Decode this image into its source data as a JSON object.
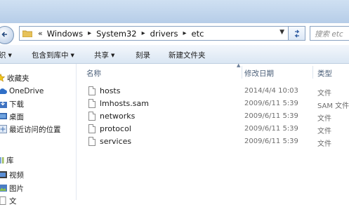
{
  "address": {
    "overflow": "«",
    "crumbs": [
      "Windows",
      "System32",
      "drivers",
      "etc"
    ],
    "separator": "▸",
    "refresh_icon": "refresh-icon"
  },
  "search": {
    "placeholder": "搜索 etc"
  },
  "toolbar": {
    "organize": "织",
    "include_in_library": "包含到库中",
    "share": "共享",
    "burn": "刻录",
    "new_folder": "新建文件夹",
    "dropdown_glyph": "▼"
  },
  "sidebar": {
    "favorites": "收藏夹",
    "onedrive": "OneDrive",
    "downloads": "下载",
    "desktop": "桌面",
    "recent": "最近访问的位置",
    "libraries": "库",
    "videos": "视频",
    "pictures": "图片",
    "documents": "文"
  },
  "columns": {
    "name": "名称",
    "modified": "修改日期",
    "type": "类型"
  },
  "files": [
    {
      "name": "hosts",
      "modified": "2014/4/4 10:03",
      "type": "文件"
    },
    {
      "name": "lmhosts.sam",
      "modified": "2009/6/11 5:39",
      "type": "SAM 文件"
    },
    {
      "name": "networks",
      "modified": "2009/6/11 5:39",
      "type": "文件"
    },
    {
      "name": "protocol",
      "modified": "2009/6/11 5:39",
      "type": "文件"
    },
    {
      "name": "services",
      "modified": "2009/6/11 5:39",
      "type": "文件"
    }
  ],
  "colors": {
    "titlebar": "#cfe0f2",
    "toolbar": "#e4edf7",
    "column_header_text": "#4c607a",
    "accent_blue": "#2d5aa0"
  }
}
